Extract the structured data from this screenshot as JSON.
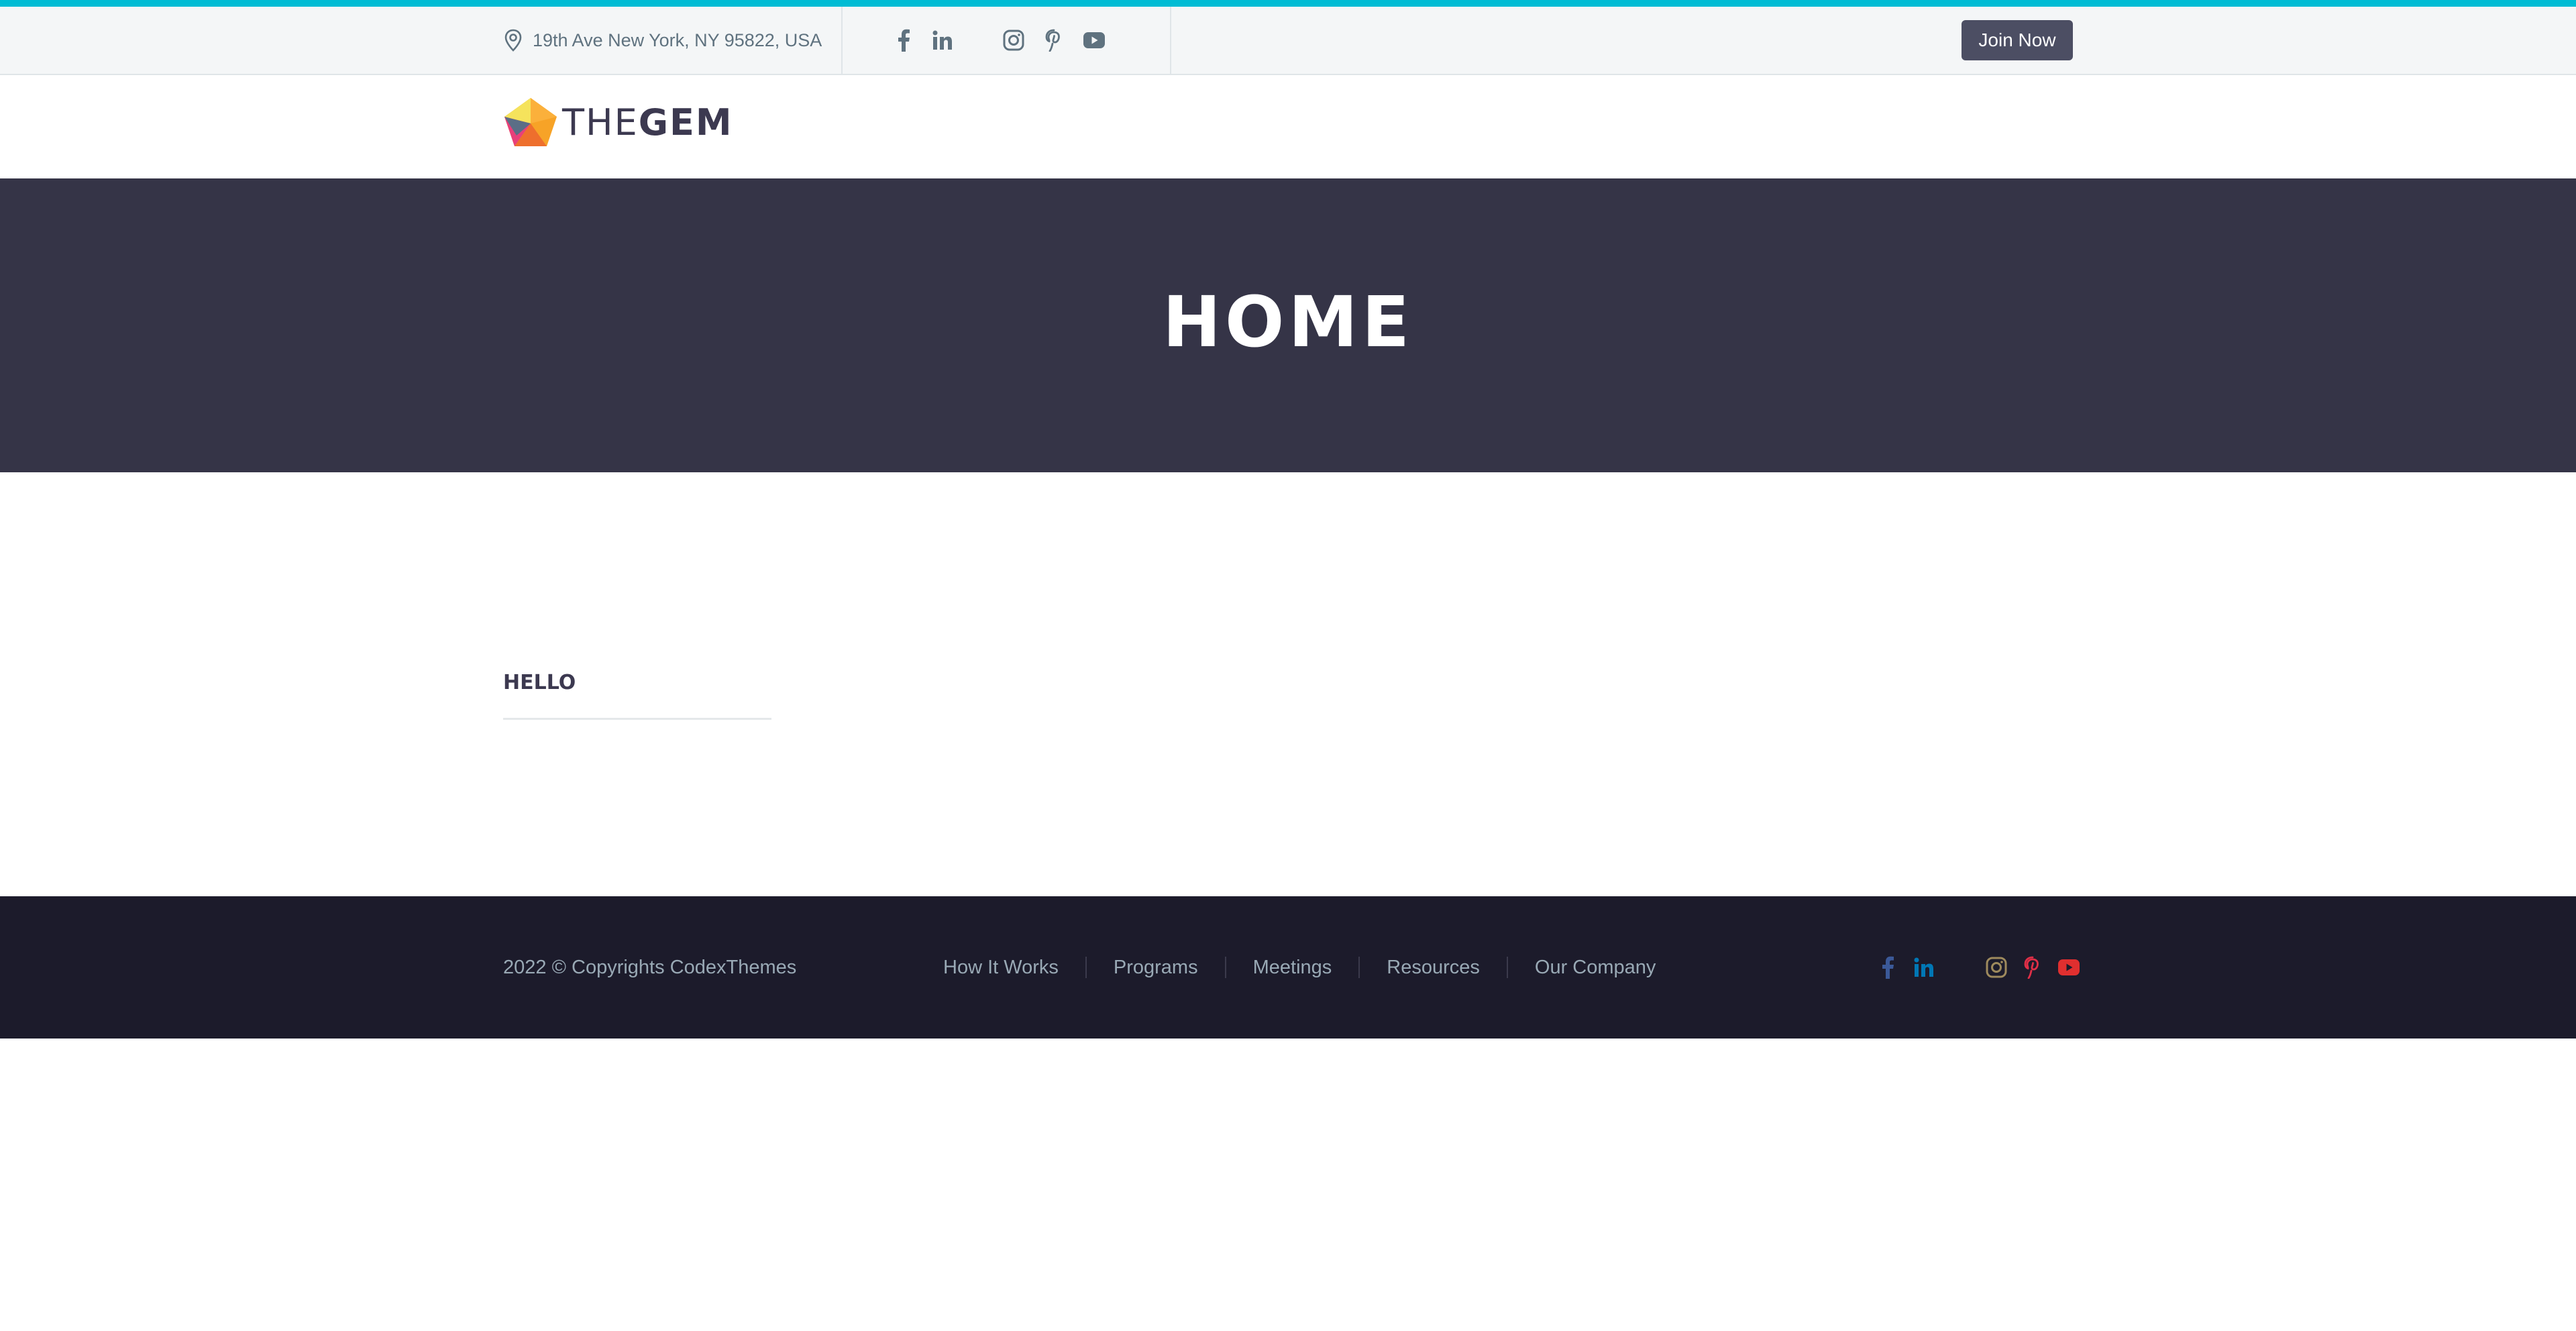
{
  "topbar": {
    "address": "19th Ave New York, NY 95822, USA",
    "social_icons": [
      "facebook-icon",
      "linkedin-icon",
      "instagram-icon",
      "pinterest-icon",
      "youtube-icon"
    ],
    "join_label": "Join Now"
  },
  "header": {
    "logo": {
      "part1": "THE",
      "part2": "GEM"
    }
  },
  "hero": {
    "title": "HOME"
  },
  "content": {
    "heading": "HELLO"
  },
  "footer": {
    "copyright": "2022 © Copyrights CodexThemes",
    "nav": [
      "How It Works",
      "Programs",
      "Meetings",
      "Resources",
      "Our Company"
    ],
    "social_icons": [
      "facebook-icon",
      "linkedin-icon",
      "instagram-icon",
      "pinterest-icon",
      "youtube-icon"
    ]
  },
  "colors": {
    "accent": "#00bcd4",
    "hero_bg": "#353447",
    "footer_bg": "#1c1b2b",
    "button_bg": "#4c4e63",
    "facebook": "#3b5998",
    "linkedin": "#0077b5",
    "instagram": "#9e8a5d",
    "pinterest": "#e02f47",
    "youtube": "#e02f2f"
  }
}
